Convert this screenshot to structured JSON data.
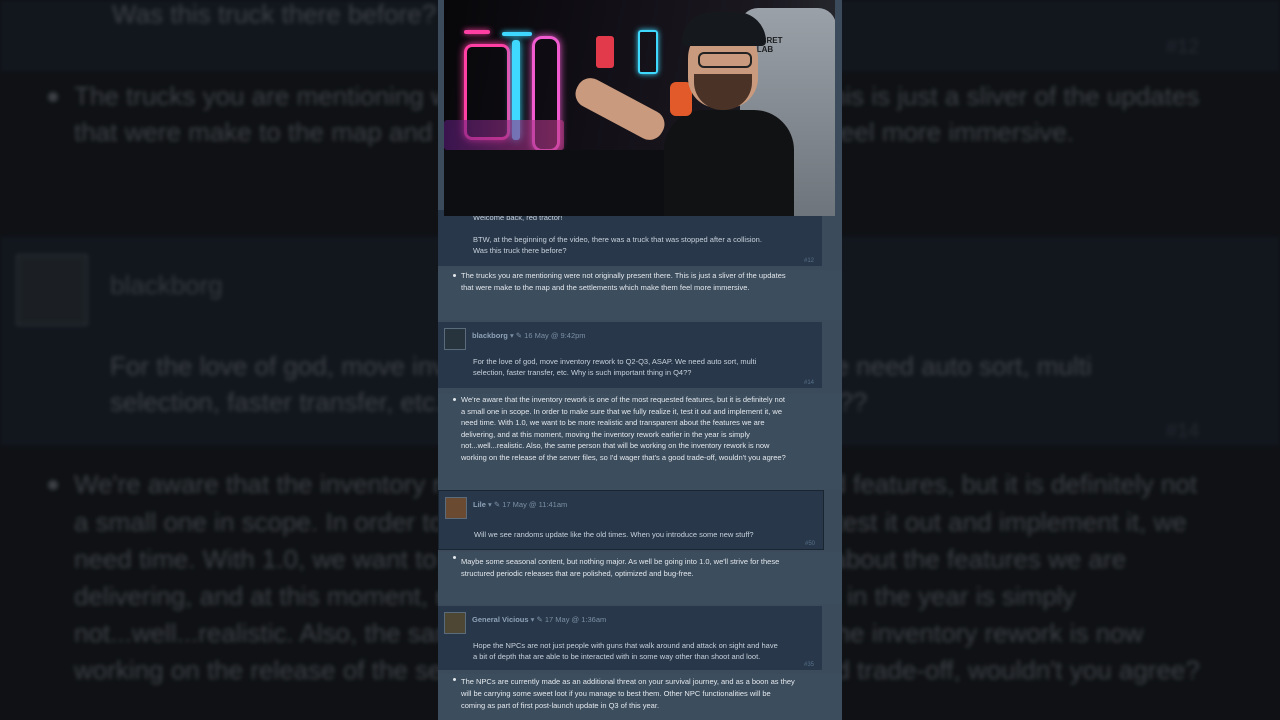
{
  "background": {
    "lines": [
      "Was this truck there before?",
      "The trucks you are mentioning were not originally present there. This is just a sliver of the updates",
      "that were make to the map and the settlements which make them feel more immersive.",
      "blackborg",
      "For the love of god, move inventory rework to Q2-Q3, ASAP. We need auto sort, multi",
      "selection, faster transfer, etc. Why is such important thing in Q4??",
      "We're aware that the inventory rework is one of the most requested features, but it is definitely not",
      "a small one in scope. In order to make sure that we fully realize it, test it out and implement it, we",
      "need time. With 1.0, we want to be more realistic and transparent about the features we are",
      "delivering, and at this moment, moving the inventory rework earlier in the year is simply",
      "not...well...realistic. Also, the same person that will be working on the inventory rework is now",
      "working on the release of the server files, so I'd wager that's a good trade-off, wouldn't you agree?"
    ],
    "nums": [
      "#12",
      "#14"
    ]
  },
  "webcam": {
    "chair_brand": "SECRET LAB",
    "colors": {
      "neon_pink": "#ff3fa4",
      "neon_cyan": "#3fd8ff",
      "neon_red": "#e23a4a",
      "mic": "#e25a2a"
    }
  },
  "comments": [
    {
      "reply_lines": [
        "Welcome back, red tractor!",
        "",
        "BTW, at the beginning of the video, there was a truck that was stopped after a collision.",
        "Was this truck there before?"
      ],
      "num": "#12",
      "answer_lines": [
        "The trucks you are mentioning were not originally present there. This is just a sliver of the updates",
        "that were make to the map and the settlements which make them feel more immersive."
      ]
    },
    {
      "author": "blackborg",
      "meta": "16 May @ 9:42pm",
      "reply_lines": [
        "For the love of god, move inventory rework to Q2-Q3, ASAP. We need auto sort, multi",
        "selection, faster transfer, etc. Why is such important thing in Q4??"
      ],
      "num": "#14",
      "answer_lines": [
        "We're aware that the inventory rework is one of the most requested features, but it is definitely not",
        "a small one in scope. In order to make sure that we fully realize it, test it out and implement it, we",
        "need time. With 1.0, we want to be more realistic and transparent about the features we are",
        "delivering, and at this moment, moving the inventory rework earlier in the year is simply",
        "not...well...realistic. Also, the same person that will be working on the inventory rework is now",
        "working on the release of the server files, so I'd wager that's a good trade-off, wouldn't you agree?"
      ]
    },
    {
      "author": "Lile",
      "meta": "17 May @ 11:41am",
      "reply_lines": [
        "Will we see randoms update like the old times. When you introduce some new stuff?"
      ],
      "num": "#50",
      "answer_lines": [
        "Maybe some seasonal content, but nothing major. As well be going into 1.0, we'll strive for these",
        "structured periodic releases that are polished, optimized and bug-free."
      ]
    },
    {
      "author": "General Vicious",
      "meta": "17 May @ 1:36am",
      "reply_lines": [
        "Hope the NPCs are not just people with guns that walk around and attack on sight and have",
        "a bit of depth that are able to be interacted with in some way other than shoot and loot."
      ],
      "num": "#35",
      "answer_lines": [
        "The NPCs are currently made as an additional threat on your survival journey, and as a boon as they",
        "will be carrying some sweet loot if you manage to best them. Other NPC functionalities will be",
        "coming as part of first post-launch update in Q3 of this year."
      ]
    }
  ]
}
